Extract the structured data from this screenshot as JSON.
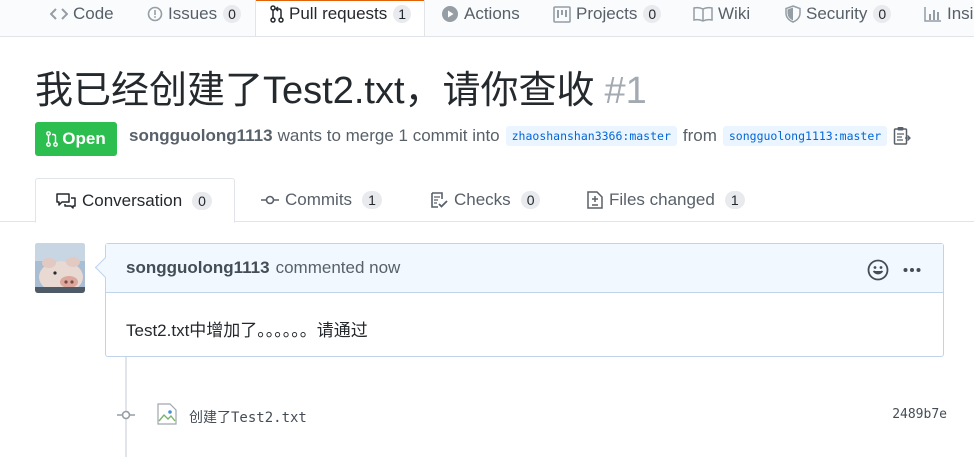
{
  "repo_nav": {
    "items": [
      {
        "label": "Code",
        "icon": "code-icon"
      },
      {
        "label": "Issues",
        "icon": "issue-opened-icon",
        "count": "0"
      },
      {
        "label": "Pull requests",
        "icon": "git-pull-request-icon",
        "count": "1",
        "selected": true
      },
      {
        "label": "Actions",
        "icon": "play-icon"
      },
      {
        "label": "Projects",
        "icon": "project-icon",
        "count": "0"
      },
      {
        "label": "Wiki",
        "icon": "book-icon"
      },
      {
        "label": "Security",
        "icon": "shield-icon",
        "count": "0"
      },
      {
        "label": "Insi",
        "icon": "graph-icon"
      }
    ]
  },
  "pr": {
    "title": "我已经创建了Test2.txt，请你查收",
    "number": "#1",
    "state": "Open",
    "author": "songguolong1113",
    "merge_text": "wants to merge 1 commit into",
    "base_branch": "zhaoshanshan3366:master",
    "from_text": "from",
    "head_branch": "songguolong1113:master"
  },
  "tabs": [
    {
      "label": "Conversation",
      "count": "0",
      "icon": "comment-discussion-icon",
      "selected": true
    },
    {
      "label": "Commits",
      "count": "1",
      "icon": "git-commit-icon"
    },
    {
      "label": "Checks",
      "count": "0",
      "icon": "checklist-icon"
    },
    {
      "label": "Files changed",
      "count": "1",
      "icon": "file-diff-icon"
    }
  ],
  "comment": {
    "author": "songguolong1113",
    "action": "commented now",
    "body": "Test2.txt中增加了。。。。。。请通过"
  },
  "commit": {
    "message": "创建了Test2.txt",
    "sha": "2489b7e"
  },
  "colors": {
    "open_green": "#2cbe4e",
    "tab_accent": "#e36209",
    "link_blue": "#0366d6",
    "comment_header_bg": "#f1f8ff"
  }
}
